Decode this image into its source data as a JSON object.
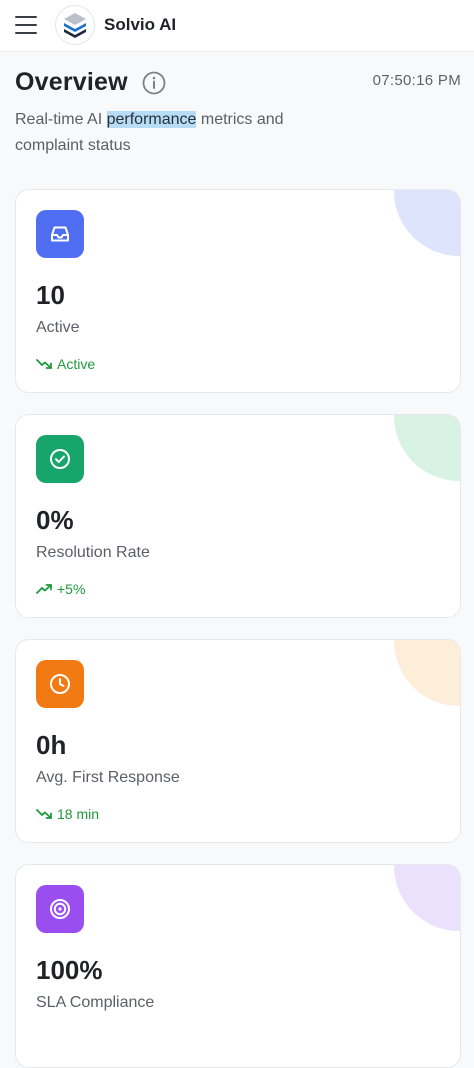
{
  "header": {
    "app_title": "Solvio AI",
    "menu_icon": "hamburger-menu-icon",
    "logo_icon": "layers-logo-icon"
  },
  "overview": {
    "title": "Overview",
    "info_icon": "info-icon",
    "time": "07:50:16 PM",
    "subtitle_before": "Real-time AI ",
    "subtitle_highlight": "performance",
    "subtitle_after": " metrics and complaint status"
  },
  "cards": [
    {
      "value": "10",
      "label": "Active",
      "trend": "Active",
      "trend_icon": "trending-down-icon",
      "icon": "inbox-icon",
      "color": "#4f6ef2",
      "deco_color": "#dde4fc"
    },
    {
      "value": "0%",
      "label": "Resolution Rate",
      "trend": "+5%",
      "trend_icon": "trending-up-icon",
      "icon": "check-circle-icon",
      "color": "#18a56b",
      "deco_color": "#d8f2e4"
    },
    {
      "value": "0h",
      "label": "Avg. First Response",
      "trend": "18 min",
      "trend_icon": "trending-down-icon",
      "icon": "clock-icon",
      "color": "#f27a12",
      "deco_color": "#fdeed9"
    },
    {
      "value": "100%",
      "label": "SLA Compliance",
      "trend": "",
      "trend_icon": "",
      "icon": "target-icon",
      "color": "#9a4ef0",
      "deco_color": "#ece1fc"
    }
  ],
  "colors": {
    "trend_green": "#1e9a3c",
    "text_dark": "#1f2328",
    "text_muted": "#5a6068"
  }
}
